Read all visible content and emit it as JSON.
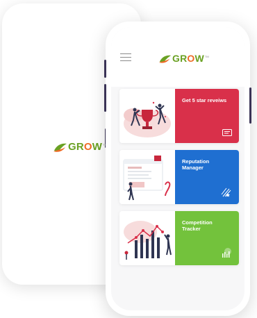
{
  "brand": {
    "name_part1": "GR",
    "name_o": "O",
    "name_part2": "W",
    "sup": "TM",
    "green": "#6aa123",
    "orange": "#ee6a24"
  },
  "splash": {
    "icon": "grow-leaf-logo-icon"
  },
  "header": {
    "menu_icon": "hamburger-icon"
  },
  "cards": [
    {
      "label": "Get 5 star reveiws",
      "color": "#d9304a",
      "icon": "review-card-icon"
    },
    {
      "label": "Reputation Manager",
      "color": "#1f6fd1",
      "icon": "stars-icon"
    },
    {
      "label": "Competition Tracker",
      "color": "#73c23c",
      "icon": "bar-chart-icon"
    }
  ]
}
